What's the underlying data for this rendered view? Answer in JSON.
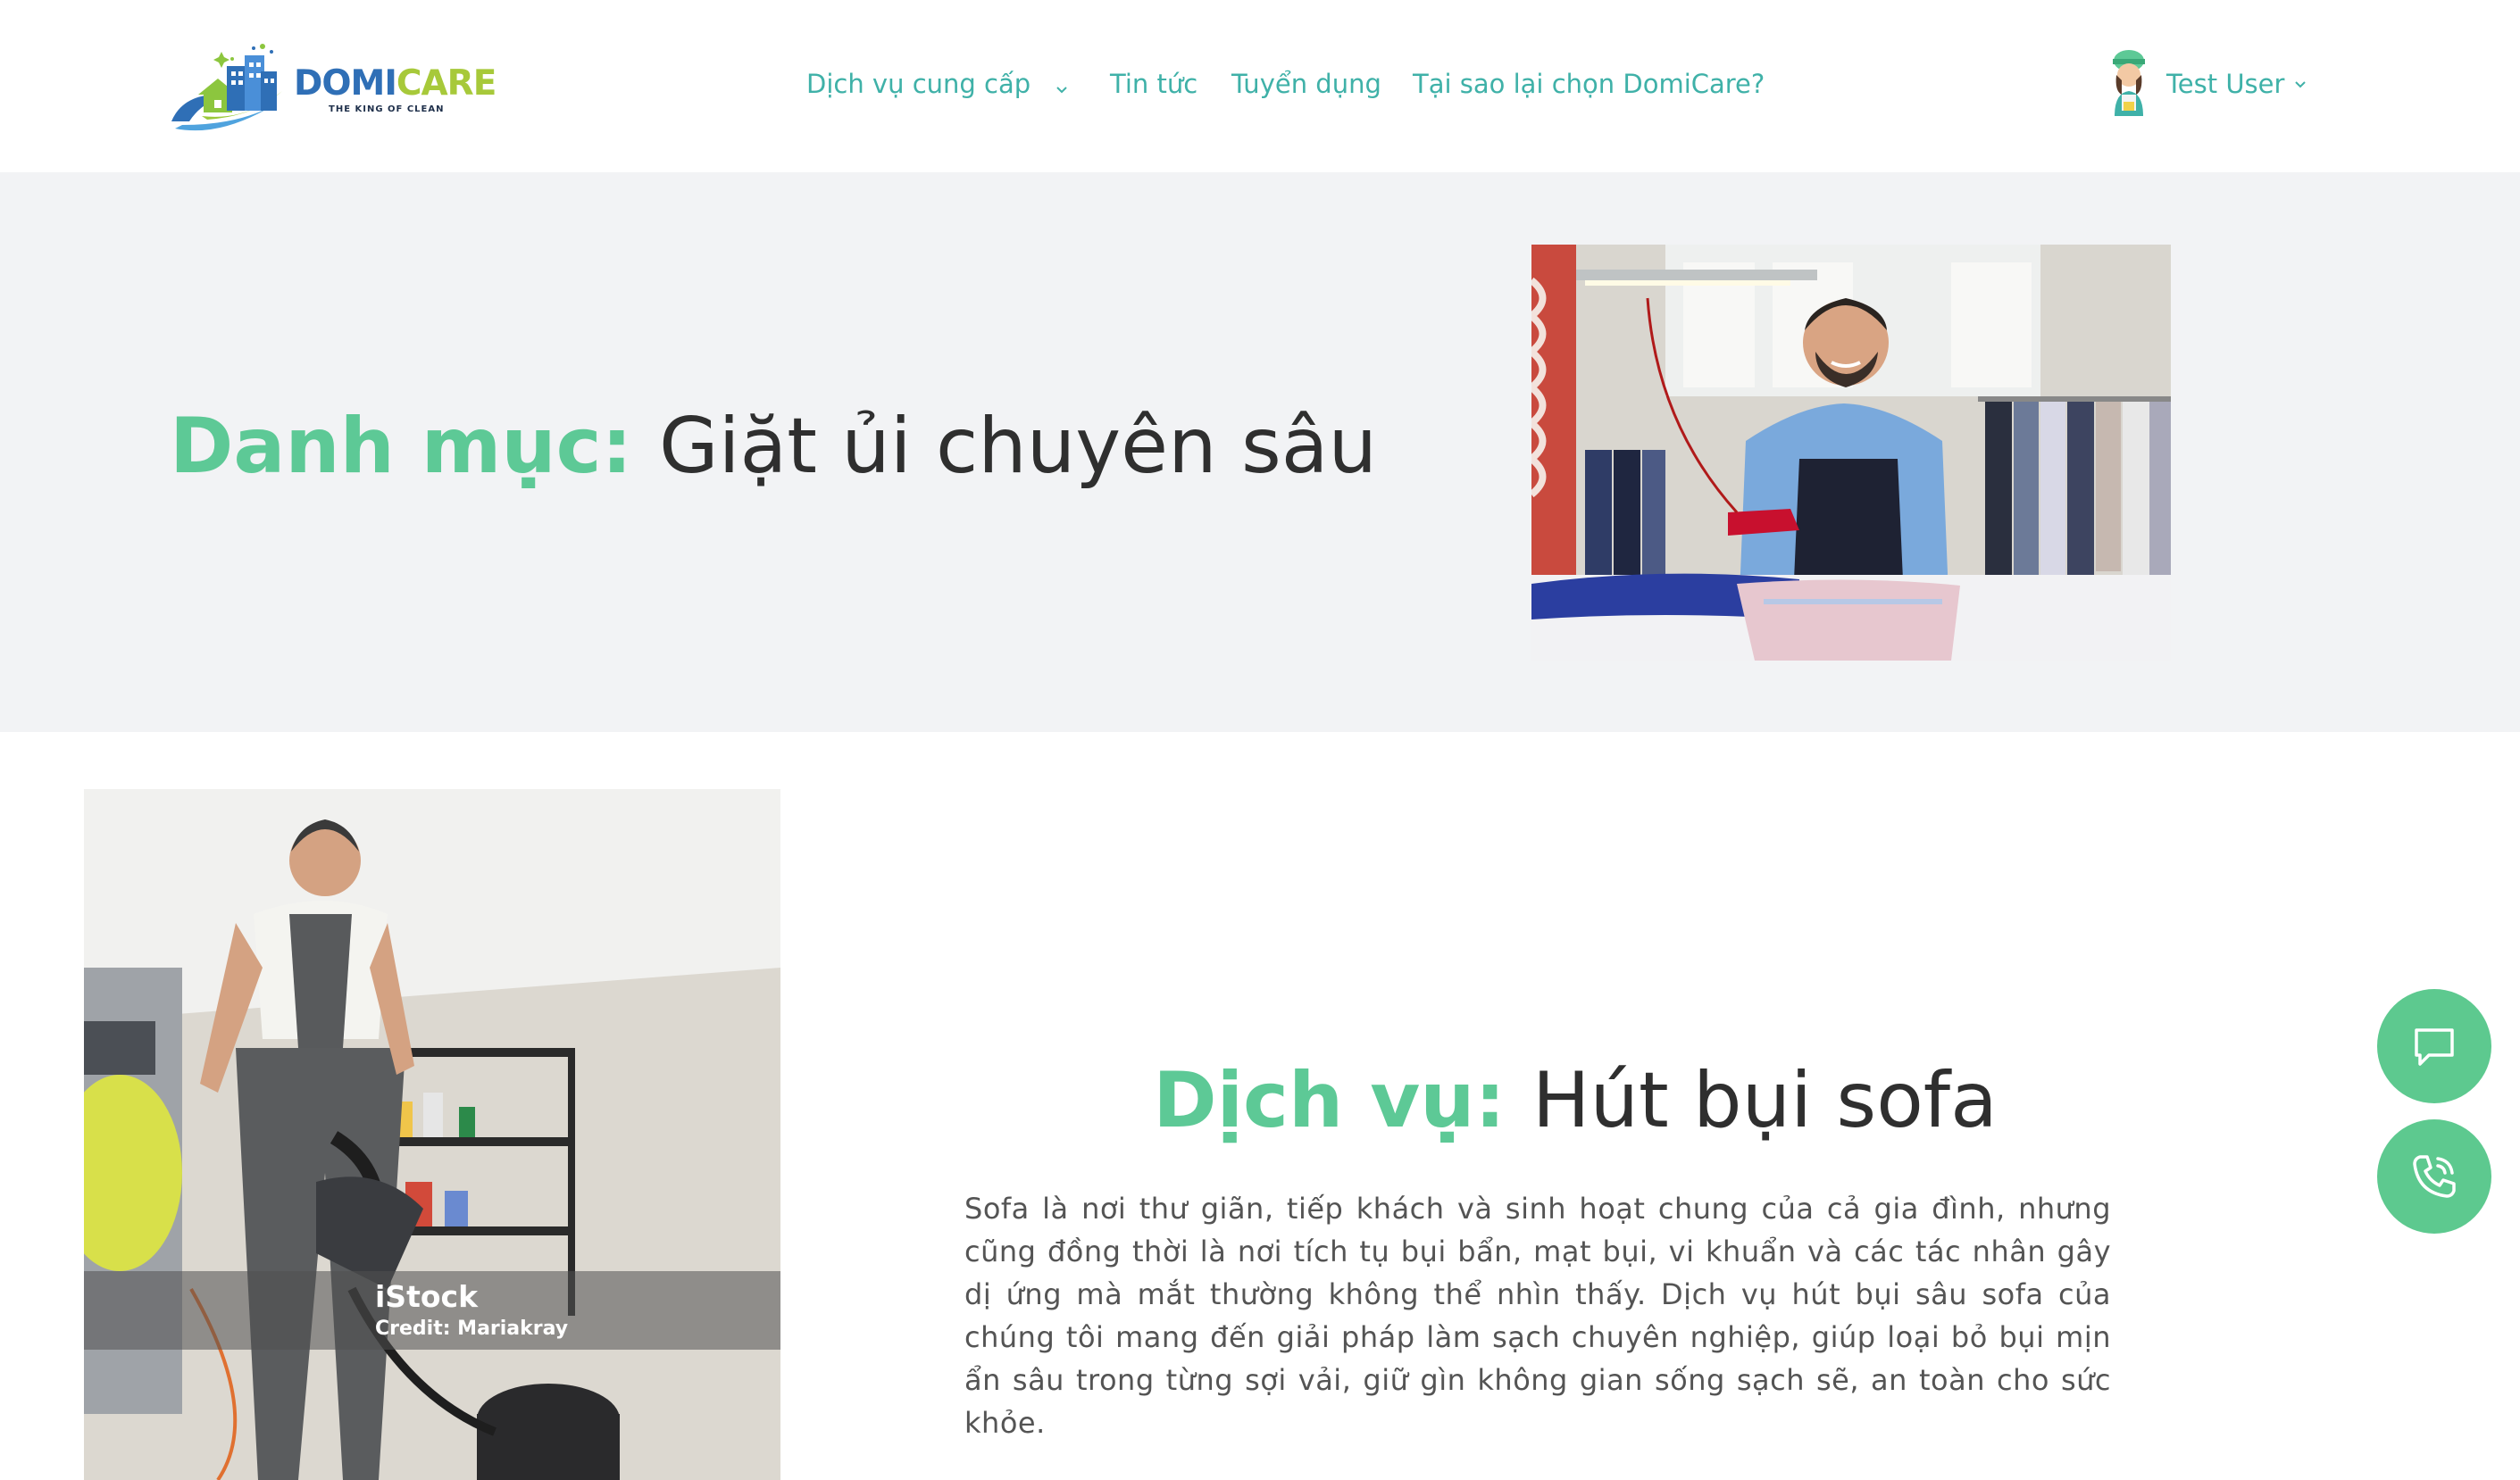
{
  "brand": {
    "name_part1": "DOMI",
    "name_part2": "CARE",
    "tagline": "THE KING OF CLEAN"
  },
  "nav": {
    "items": [
      {
        "label": "Dịch vụ cung cấp",
        "has_dropdown": true
      },
      {
        "label": "Tin tức"
      },
      {
        "label": "Tuyển dụng"
      },
      {
        "label": "Tại sao lại chọn DomiCare?"
      }
    ]
  },
  "user": {
    "name": "Test User"
  },
  "hero": {
    "title_prefix": "Danh mục:",
    "title_value": "Giặt ủi chuyên sâu"
  },
  "service": {
    "title_prefix": "Dịch vụ:",
    "title_value": "Hút bụi sofa",
    "description": "Sofa là nơi thư giãn, tiếp khách và sinh hoạt chung của cả gia đình, nhưng cũng đồng thời là nơi tích tụ bụi bẩn, mạt bụi, vi khuẩn và các tác nhân gây dị ứng mà mắt thường không thể nhìn thấy. Dịch vụ hút bụi sâu sofa của chúng tôi mang đến giải pháp làm sạch chuyên nghiệp, giúp loại bỏ bụi mịn ẩn sâu trong từng sợi vải, giữ gìn không gian sống sạch sẽ, an toàn cho sức khỏe.",
    "image_watermark_brand": "iStock",
    "image_watermark_credit": "Credit: Mariakray"
  },
  "floating": {
    "chat_icon": "chat-bubble-icon",
    "phone_icon": "phone-call-icon"
  },
  "colors": {
    "accent_green": "#5dc996",
    "nav_teal": "#3fb1a8",
    "hero_bg": "#f2f3f5",
    "fab_green": "#5dc98f"
  }
}
